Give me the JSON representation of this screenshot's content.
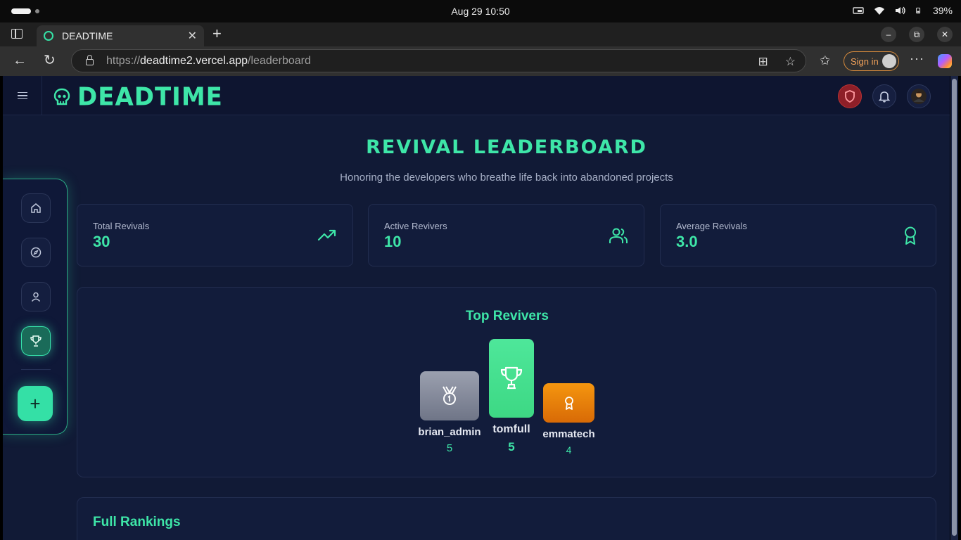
{
  "os": {
    "clock": "Aug 29  10:50",
    "battery": "39%"
  },
  "browser": {
    "tab_title": "DEADTIME",
    "tab_close": "✕",
    "new_tab": "+",
    "url_prefix": "https://",
    "url_domain": "deadtime2.vercel.app",
    "url_path": "/leaderboard",
    "sign_in": "Sign in",
    "more": "···"
  },
  "app": {
    "logo_text": "DEADTIME",
    "page_title": "REVIVAL LEADERBOARD",
    "page_subtitle": "Honoring the developers who breathe life back into abandoned projects",
    "stats": [
      {
        "label": "Total Revivals",
        "value": "30",
        "icon": "trending-up-icon"
      },
      {
        "label": "Active Revivers",
        "value": "10",
        "icon": "users-icon"
      },
      {
        "label": "Average Revivals",
        "value": "3.0",
        "icon": "award-icon"
      }
    ],
    "top_title": "Top Revivers",
    "podium": [
      {
        "name": "brian_admin",
        "score": "5",
        "place": 2,
        "icon": "medal-icon",
        "color": "#8a90a2"
      },
      {
        "name": "tomfull",
        "score": "5",
        "place": 1,
        "icon": "trophy-icon",
        "color": "#45df8e"
      },
      {
        "name": "emmatech",
        "score": "4",
        "place": 3,
        "icon": "award-icon",
        "color": "#f08a10"
      }
    ],
    "rankings_title": "Full Rankings",
    "fab_label": "+"
  },
  "colors": {
    "accent": "#3ee6a8",
    "bg": "#111a36",
    "danger": "#8e1f28"
  }
}
